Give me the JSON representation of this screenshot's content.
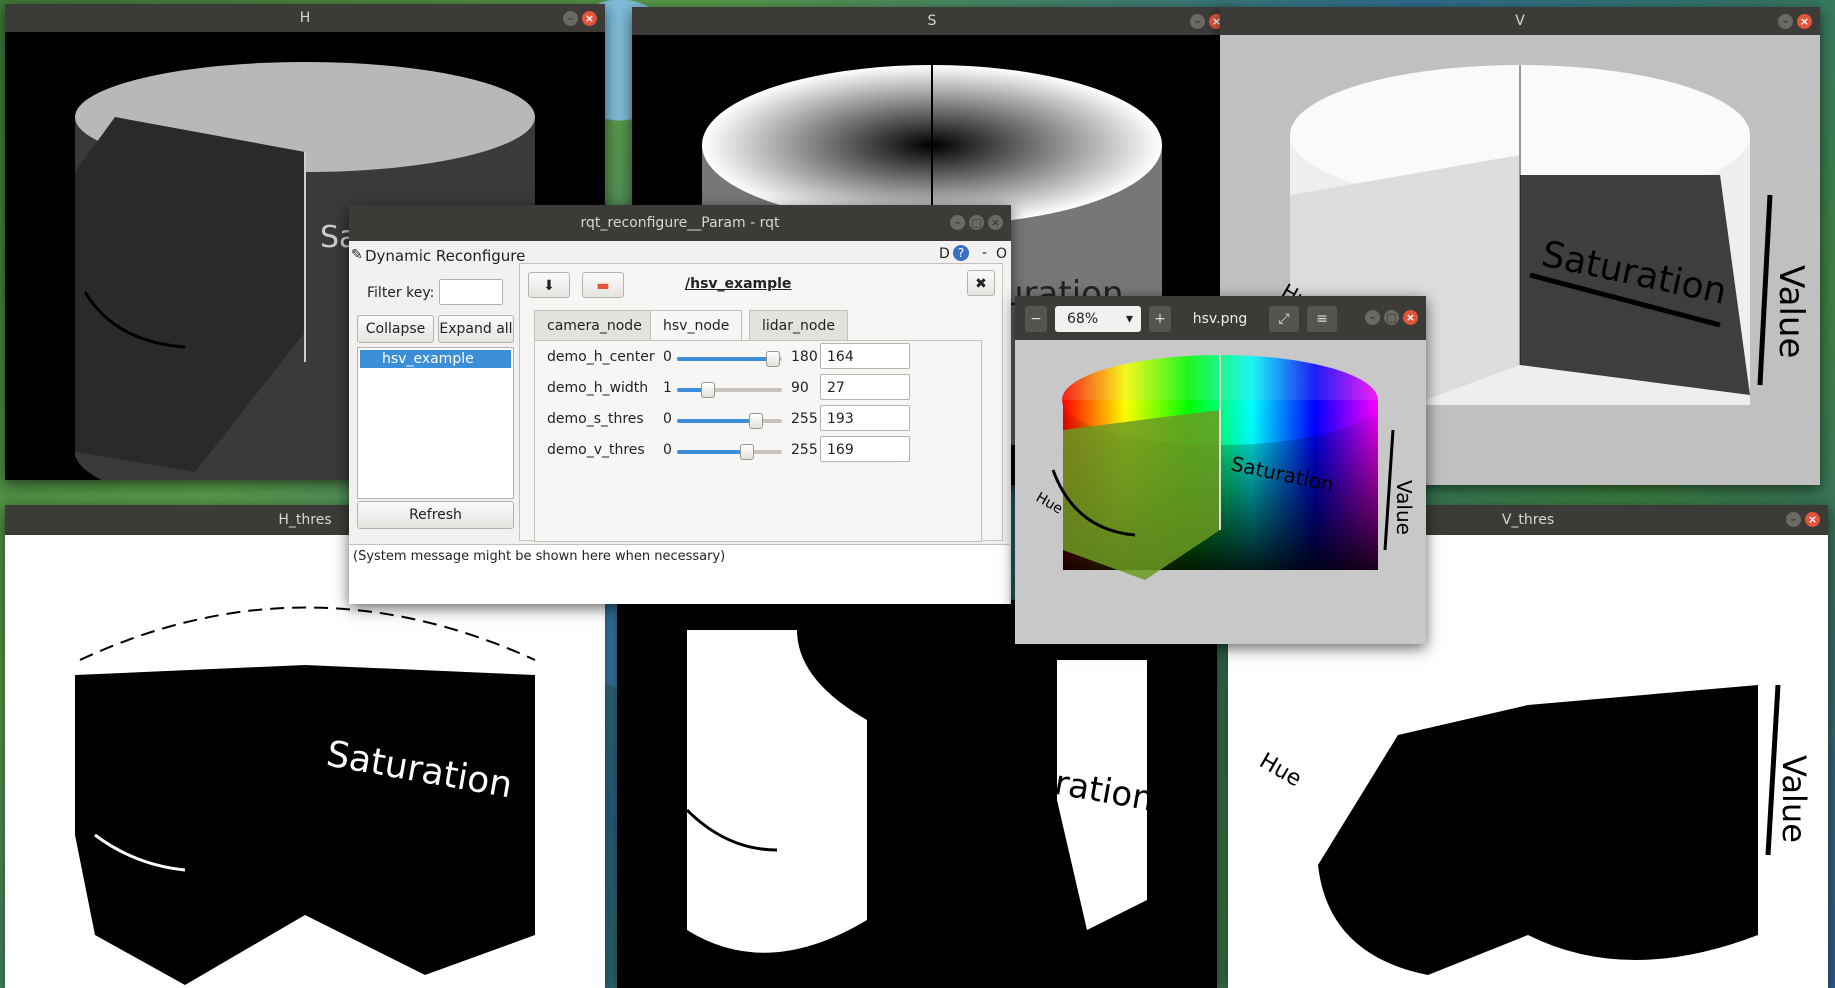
{
  "windows": {
    "h": {
      "title": "H"
    },
    "s": {
      "title": "S"
    },
    "v": {
      "title": "V"
    },
    "h_thres": {
      "title": "H_thres"
    },
    "v_thres": {
      "title": "V_thres"
    }
  },
  "image_text": {
    "saturation": "Saturation",
    "value": "Value",
    "hue": "Hue",
    "s_partial": "Sa",
    "s_window_partial": "uration",
    "s_thres_partial": "Saturation"
  },
  "rqt": {
    "title": "rqt_reconfigure__Param - rqt",
    "plugin_label": "Dynamic Reconfigure",
    "plugin_buttons": {
      "d": "D",
      "help": "?",
      "minus": "-",
      "o": "O"
    },
    "filter_label": "Filter key:",
    "filter_value": "",
    "collapse_all": "Collapse all",
    "expand_all": "Expand all",
    "tree_items": [
      "hsv_example"
    ],
    "refresh": "Refresh",
    "node_title": "/hsv_example",
    "tabs": [
      "camera_node",
      "hsv_node",
      "lidar_node"
    ],
    "active_tab": "hsv_node",
    "params": [
      {
        "name": "demo_h_center",
        "min": "0",
        "max": "180",
        "value": "164",
        "fraction": 0.911
      },
      {
        "name": "demo_h_width",
        "min": "1",
        "max": "90",
        "value": "27",
        "fraction": 0.292
      },
      {
        "name": "demo_s_thres",
        "min": "0",
        "max": "255",
        "value": "193",
        "fraction": 0.757
      },
      {
        "name": "demo_v_thres",
        "min": "0",
        "max": "255",
        "value": "169",
        "fraction": 0.663
      }
    ],
    "system_message": "(System message might be shown here when necessary)"
  },
  "viewer": {
    "zoom": "68%",
    "filename": "hsv.png",
    "zoom_out": "−",
    "zoom_in": "+",
    "expand": "⤢",
    "menu": "≡"
  },
  "colors": {
    "selection": "#3d8ed8",
    "titlebar": "#3c3b37",
    "close": "#e2553a"
  }
}
